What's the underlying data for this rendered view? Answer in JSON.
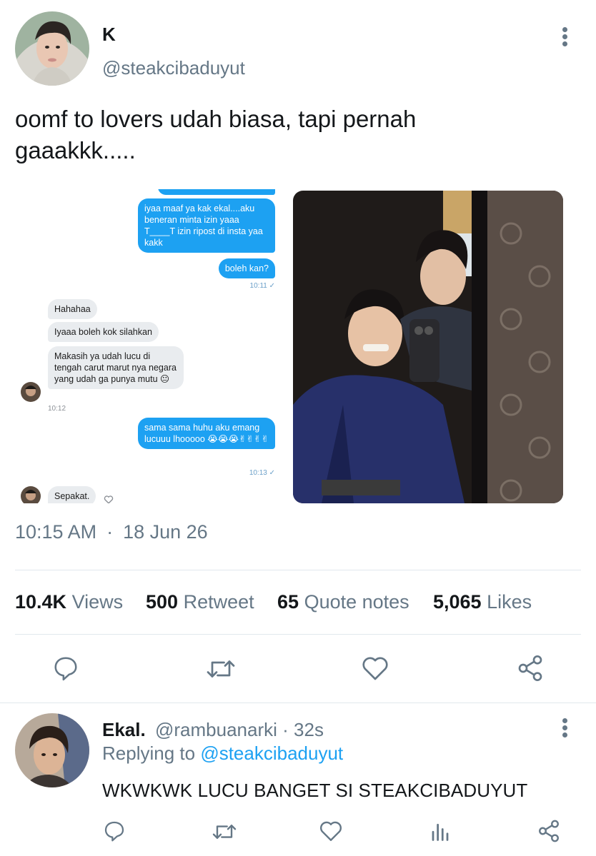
{
  "tweet": {
    "author_name": "K",
    "author_handle": "@steakcibaduyut",
    "text_line1": "oomf to lovers udah biasa, tapi pernah",
    "text_line2": "gaaakkk.....",
    "time": "10:15 AM",
    "separator": "·",
    "date": "18 Jun 26"
  },
  "chat": {
    "messages": [
      {
        "side": "out",
        "text": "iyaa maaf ya kak ekal....aku beneran minta izin yaaa T____T izin ripost di insta yaa kakk"
      },
      {
        "side": "out",
        "text": "boleh kan?"
      },
      {
        "time": "10:11 ✓"
      },
      {
        "side": "in",
        "text": "Hahahaa"
      },
      {
        "side": "in",
        "text": "Iyaaa boleh kok silahkan"
      },
      {
        "side": "in",
        "text": "Makasih ya udah lucu di tengah carut marut nya negara yang udah ga punya mutu 😐"
      },
      {
        "time": "10:12"
      },
      {
        "side": "out",
        "text": "sama sama huhu aku emang lucuuu lhooooo 😭😭😭✌✌✌✌"
      },
      {
        "time": "10:13 ✓"
      },
      {
        "side": "in",
        "text": "Sepakat."
      }
    ]
  },
  "stats": {
    "views_count": "10.4K",
    "views_label": "Views",
    "retweet_count": "500",
    "retweet_label": "Retweet",
    "quote_count": "65",
    "quote_label": "Quote notes",
    "likes_count": "5,065",
    "likes_label": "Likes"
  },
  "reply": {
    "author_name": "Ekal.",
    "author_handle": "@rambuanarki",
    "time": "· 32s",
    "replying_prefix": "Replying to",
    "replying_handle": "@steakcibaduyut",
    "text": "WKWKWK LUCU BANGET SI STEAKCIBADUYUT"
  },
  "icons": {
    "reply": "reply-icon",
    "retweet": "retweet-icon",
    "like": "heart-icon",
    "share": "share-icon",
    "views": "views-icon",
    "more": "more-vertical-icon"
  },
  "colors": {
    "accent": "#1da1f2",
    "text_primary": "#14171a",
    "text_secondary": "#657786",
    "divider": "#e1e8ed"
  }
}
